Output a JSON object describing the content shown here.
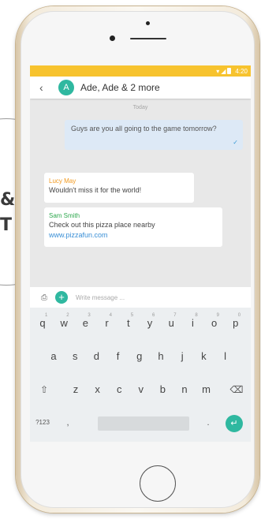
{
  "colors": {
    "status_bar": "#f7c32e",
    "accent": "#2fb8a0",
    "outgoing_bubble": "#dde9f6",
    "chat_background": "#e8e8e8"
  },
  "status": {
    "time": "4:20"
  },
  "conversation": {
    "avatar_letter": "A",
    "title": "Ade, Ade & 2 more",
    "date_divider": "Today"
  },
  "messages": [
    {
      "direction": "outgoing",
      "text": "Guys are you all going to the game tomorrow?"
    },
    {
      "direction": "incoming",
      "sender": "Lucy May",
      "text": "Wouldn't miss it for the world!"
    },
    {
      "direction": "incoming",
      "sender": "Sam Smith",
      "text": "Check out this pizza place nearby",
      "link": "www.pizzafun.com"
    }
  ],
  "compose": {
    "placeholder": "Write message ..."
  },
  "keyboard": {
    "row1": [
      {
        "key": "q",
        "sub": "1"
      },
      {
        "key": "w",
        "sub": "2"
      },
      {
        "key": "e",
        "sub": "3"
      },
      {
        "key": "r",
        "sub": "4"
      },
      {
        "key": "t",
        "sub": "5"
      },
      {
        "key": "y",
        "sub": "6"
      },
      {
        "key": "u",
        "sub": "7"
      },
      {
        "key": "i",
        "sub": "8"
      },
      {
        "key": "o",
        "sub": "9"
      },
      {
        "key": "p",
        "sub": "0"
      }
    ],
    "row2": [
      "a",
      "s",
      "d",
      "f",
      "g",
      "h",
      "j",
      "k",
      "l"
    ],
    "row3": [
      "z",
      "x",
      "c",
      "v",
      "b",
      "n",
      "m"
    ],
    "symbols_label": "?123",
    "comma": ",",
    "period": "."
  },
  "background_letters": [
    "&",
    "T"
  ],
  "icons": {
    "back": "back-arrow-icon",
    "check": "check-icon",
    "attach": "attach-icon",
    "add": "add-icon",
    "shift": "shift-icon",
    "backspace": "backspace-icon",
    "enter": "enter-icon"
  }
}
